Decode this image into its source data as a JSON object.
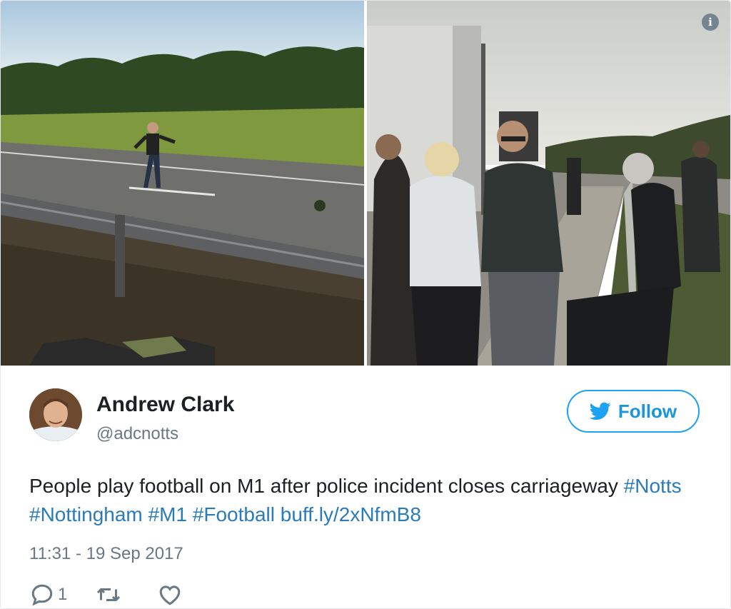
{
  "media": {
    "info_icon": "info-icon",
    "left_photo": "photo-people-playing-football-on-motorway",
    "right_photo": "photo-people-standing-beside-motorway"
  },
  "author": {
    "name": "Andrew Clark",
    "handle": "@adcnotts",
    "avatar": "avatar-photo"
  },
  "follow": {
    "label": "Follow",
    "icon": "twitter-bird-icon",
    "color": "#1da1f2"
  },
  "tweet": {
    "text_plain": "People play football on M1 after police incident closes carriageway ",
    "hashtags": [
      "#Notts",
      "#Nottingham",
      "#M1",
      "#Football"
    ],
    "link": "buff.ly/2xNfmB8",
    "link_color": "#2b7bb9"
  },
  "timestamp": "11:31 - 19 Sep 2017",
  "actions": {
    "reply_count": "1",
    "reply_icon": "reply-icon",
    "retweet_icon": "retweet-icon",
    "like_icon": "heart-icon"
  }
}
